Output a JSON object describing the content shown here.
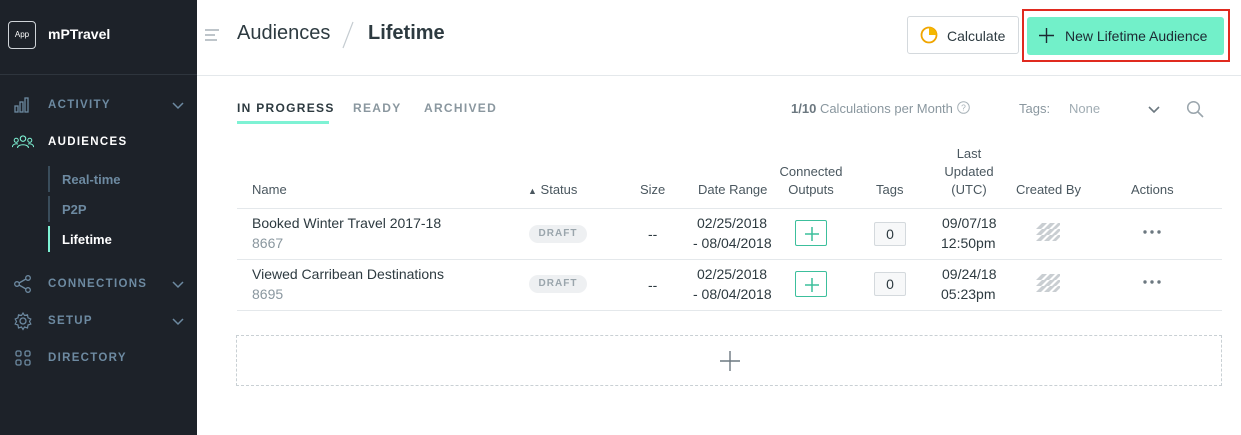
{
  "sidebar": {
    "app_badge": "App",
    "brand": "mPTravel",
    "items": [
      {
        "label": "ACTIVITY",
        "icon": "bar-chart-icon"
      },
      {
        "label": "AUDIENCES",
        "icon": "people-icon"
      },
      {
        "label": "CONNECTIONS",
        "icon": "network-icon"
      },
      {
        "label": "SETUP",
        "icon": "gear-icon"
      },
      {
        "label": "DIRECTORY",
        "icon": "grid-icon"
      }
    ],
    "sub_items": [
      {
        "label": "Real-time"
      },
      {
        "label": "P2P"
      },
      {
        "label": "Lifetime"
      }
    ]
  },
  "header": {
    "crumb_parent": "Audiences",
    "crumb_current": "Lifetime",
    "calculate_label": "Calculate",
    "new_audience_label": "New Lifetime Audience"
  },
  "tabs": [
    {
      "label": "IN PROGRESS"
    },
    {
      "label": "READY"
    },
    {
      "label": "ARCHIVED"
    }
  ],
  "toolbar": {
    "calc_used": "1/10",
    "calc_text": "Calculations per Month",
    "tags_label": "Tags:",
    "tags_value": "None"
  },
  "table": {
    "headers": {
      "name": "Name",
      "status": "Status",
      "size": "Size",
      "date_range": "Date Range",
      "outputs_l1": "Connected",
      "outputs_l2": "Outputs",
      "tags": "Tags",
      "updated_l1": "Last",
      "updated_l2": "Updated",
      "updated_l3": "(UTC)",
      "created_by": "Created By",
      "actions": "Actions"
    },
    "rows": [
      {
        "name": "Booked Winter Travel 2017-18",
        "id": "8667",
        "status": "DRAFT",
        "size": "--",
        "date_start": "02/25/2018",
        "date_end": "- 08/04/2018",
        "tags": "0",
        "updated_date": "09/07/18",
        "updated_time": "12:50pm"
      },
      {
        "name": "Viewed Carribean Destinations",
        "id": "8695",
        "status": "DRAFT",
        "size": "--",
        "date_start": "02/25/2018",
        "date_end": "- 08/04/2018",
        "tags": "0",
        "updated_date": "09/24/18",
        "updated_time": "05:23pm"
      }
    ]
  },
  "colors": {
    "sidebar_bg": "#1d2229",
    "accent": "#7ef2d4",
    "primary_button": "#72f0c9",
    "highlight_border": "#e02a1f"
  }
}
